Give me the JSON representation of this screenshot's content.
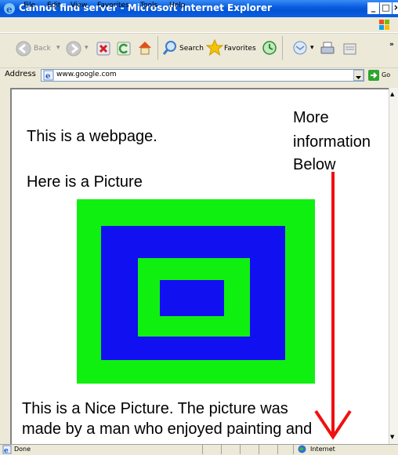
{
  "window": {
    "title": "Cannot find server - Microsoft Internet Explorer"
  },
  "menu": [
    "File",
    "Edit",
    "View",
    "Favorites",
    "Tools",
    "Help"
  ],
  "toolbar": {
    "back_label": "Back",
    "search_label": "Search",
    "favorites_label": "Favorites"
  },
  "address": {
    "label": "Address",
    "url": "www.google.com",
    "go_label": "Go"
  },
  "page": {
    "line1": "This is a webpage.",
    "line2": "Here is a Picture",
    "side_note": [
      "More",
      "information",
      "Below"
    ],
    "caption_line1": "This is a Nice Picture.  The picture was",
    "caption_line2": "made by a man who enjoyed painting and"
  },
  "picture": {
    "colors": {
      "green": "#10F010",
      "blue": "#1010F0"
    }
  },
  "arrow_color": "#F01010",
  "status": {
    "left": "Done",
    "zone": "Internet"
  }
}
